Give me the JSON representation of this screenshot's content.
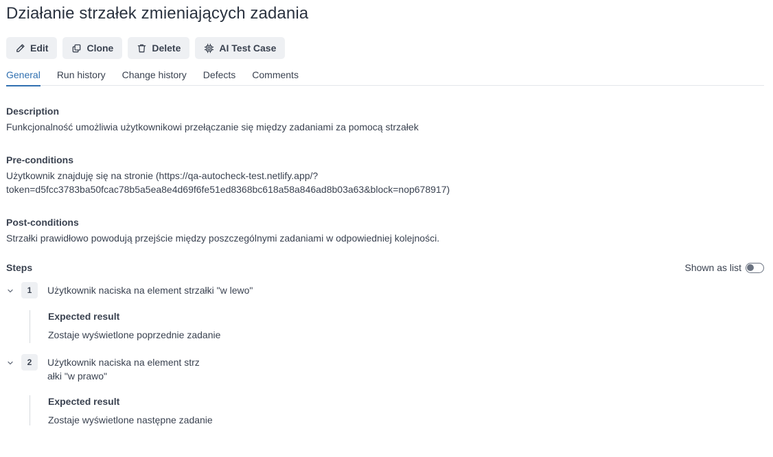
{
  "title": "Działanie strzałek zmieniających zadania",
  "toolbar": {
    "edit_label": "Edit",
    "clone_label": "Clone",
    "delete_label": "Delete",
    "ai_label": "AI Test Case"
  },
  "tabs": [
    {
      "label": "General",
      "active": true
    },
    {
      "label": "Run history"
    },
    {
      "label": "Change history"
    },
    {
      "label": "Defects"
    },
    {
      "label": "Comments"
    }
  ],
  "description": {
    "label": "Description",
    "text": "Funkcjonalność umożliwia użytkownikowi przełączanie się między zadaniami za pomocą strzałek"
  },
  "preconditions": {
    "label": "Pre-conditions",
    "line1": "Użytkownik znajduję się na stronie (https://qa-autocheck-test.netlify.app/?",
    "line2": "token=d5fcc3783ba50fcac78b5a5ea8e4d69f6fe51ed8368bc618a58a846ad8b03a63&block=nop678917)"
  },
  "postconditions": {
    "label": "Post-conditions",
    "text": "Strzałki prawidłowo powodują przejście między poszczególnymi zadaniami w odpowiedniej kolejności."
  },
  "steps": {
    "label": "Steps",
    "toggle_label": "Shown as list",
    "toggle_on": false,
    "items": [
      {
        "number": "1",
        "action_line1": "Użytkownik naciska na element strzałki \"w lewo\"",
        "action_line2": "",
        "expected_label": "Expected result",
        "expected": "Zostaje wyświetlone poprzednie zadanie"
      },
      {
        "number": "2",
        "action_line1": "Użytkownik naciska na element strz",
        "action_line2": "ałki \"w prawo\"",
        "expected_label": "Expected result",
        "expected": "Zostaje wyświetlone następne zadanie"
      }
    ]
  },
  "colors": {
    "accent": "#2f6fb0",
    "text": "#3a4250",
    "button_bg": "#eef0f3"
  }
}
